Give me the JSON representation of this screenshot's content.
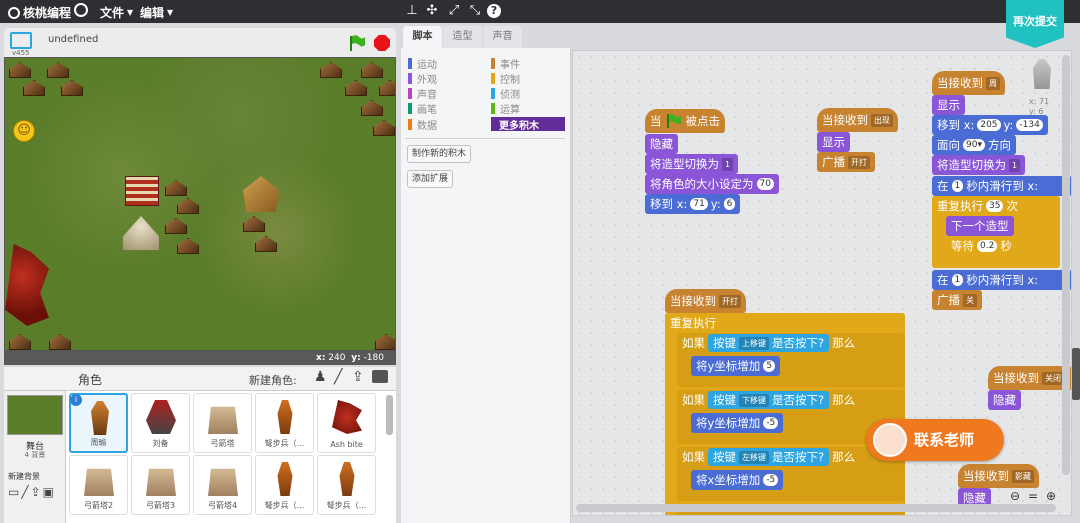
{
  "topbar": {
    "logo": "核桃编程",
    "menu_file": "文件",
    "menu_edit": "编辑",
    "republish": "再次提交"
  },
  "stage": {
    "version": "v455",
    "title": "undefined",
    "coord_x_label": "x:",
    "coord_x": "240",
    "coord_y_label": "y:",
    "coord_y": "-180"
  },
  "sprites": {
    "header": "角色",
    "new_sprite_label": "新建角色:",
    "stage_label": "舞台",
    "backdrop_count": "4 背景",
    "new_backdrop_label": "新建背景",
    "items": [
      {
        "name": "周瑜"
      },
      {
        "name": "刘备"
      },
      {
        "name": "弓箭塔"
      },
      {
        "name": "弩步兵（..."
      },
      {
        "name": "Ash bite"
      },
      {
        "name": "弓箭塔2"
      },
      {
        "name": "弓箭塔3"
      },
      {
        "name": "弓箭塔4"
      },
      {
        "name": "弩步兵（..."
      },
      {
        "name": "弩步兵（..."
      }
    ]
  },
  "tabs": [
    "脚本",
    "造型",
    "声音"
  ],
  "palette": {
    "categories_left": [
      {
        "label": "运动",
        "color": "#4a6cd4"
      },
      {
        "label": "外观",
        "color": "#8a55d7"
      },
      {
        "label": "声音",
        "color": "#bb42c3"
      },
      {
        "label": "画笔",
        "color": "#0e9a6c"
      },
      {
        "label": "数据",
        "color": "#ee7d16"
      }
    ],
    "categories_right": [
      {
        "label": "事件",
        "color": "#c88330"
      },
      {
        "label": "控制",
        "color": "#e1a91a"
      },
      {
        "label": "侦测",
        "color": "#2ca5e2"
      },
      {
        "label": "运算",
        "color": "#5cb712"
      },
      {
        "label": "更多积木",
        "color": "#632d99"
      }
    ],
    "make_block": "制作新的积木",
    "add_extension": "添加扩展"
  },
  "scripts": {
    "s1": {
      "hat": "当",
      "hat_tail": "被点击",
      "hide": "隐藏",
      "switch_costume": "将造型切换为",
      "costume_val": "1",
      "set_size": "将角色的大小设定为",
      "size_val": "70",
      "goto": "移到 x:",
      "goto_x": "71",
      "goto_y_label": "y:",
      "goto_y": "6"
    },
    "s2": {
      "hat": "当接收到",
      "msg": "出现",
      "show": "显示",
      "broadcast": "广播",
      "broadcast_msg": "开打"
    },
    "s3": {
      "hat": "当接收到",
      "msg": "周",
      "show": "显示",
      "goto": "移到 x:",
      "x": "205",
      "y_label": "y:",
      "y": "-134",
      "point": "面向",
      "dir": "90▾",
      "dir_tail": "方向",
      "switch_costume": "将造型切换为",
      "costume_val": "1",
      "glide": "在",
      "glide_secs": "1",
      "glide_tail": "秒内滑行到 x:",
      "repeat": "重复执行",
      "repeat_count": "35",
      "repeat_tail": "次",
      "next_costume": "下一个造型",
      "wait": "等待",
      "wait_val": "0.2",
      "wait_tail": "秒",
      "glide2": "在",
      "glide2_secs": "1",
      "glide2_tail": "秒内滑行到 x:",
      "broadcast": "广播",
      "broadcast_msg": "关",
      "sprite_x_label": "x: 71",
      "sprite_y_label": "y: 6"
    },
    "s4": {
      "hat": "当接收到",
      "msg": "开打",
      "forever": "重复执行",
      "if1": "如果",
      "key1": "按键",
      "key1_val": "上移键",
      "pressed": "是否按下?",
      "then": "那么",
      "change_y1": "将y坐标增加",
      "change_y1_val": "5",
      "key2_val": "下移键",
      "change_y2": "将y坐标增加",
      "change_y2_val": "-5",
      "key3_val": "左移键",
      "change_x1": "将x坐标增加",
      "change_x1_val": "-5"
    },
    "s5": {
      "hat": "当接收到",
      "msg": "关闭",
      "hide": "隐藏"
    },
    "s6": {
      "hat": "当接收到",
      "msg": "影藏",
      "hide": "隐藏"
    }
  },
  "contact_button": "联系老师"
}
